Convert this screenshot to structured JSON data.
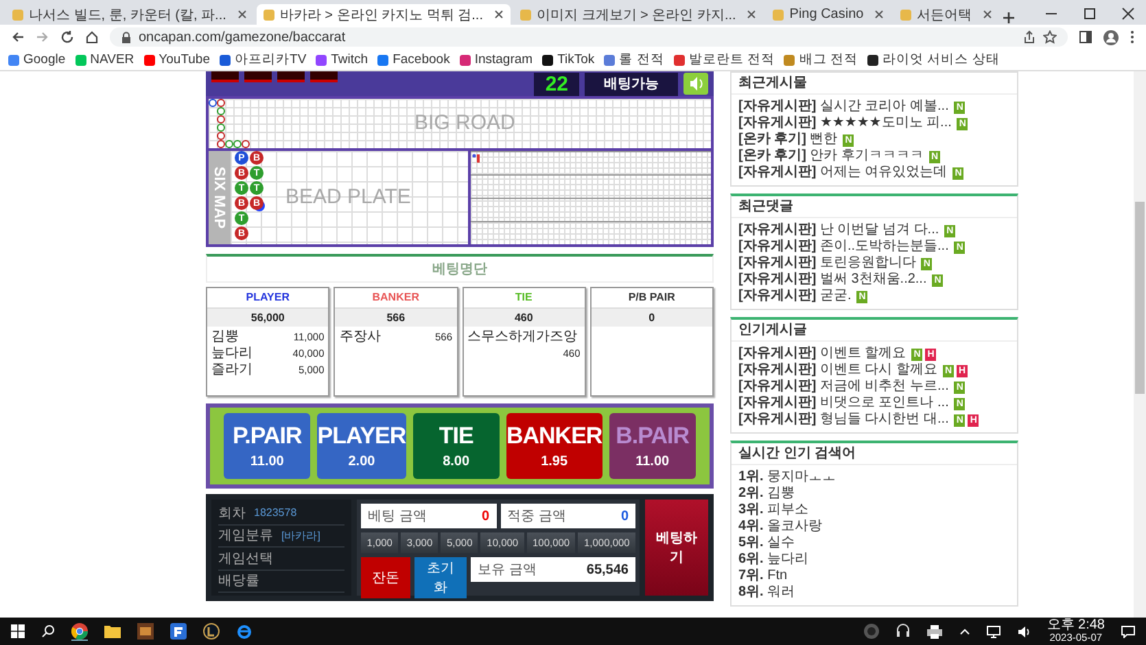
{
  "browser": {
    "tabs": [
      {
        "title": "나서스 빌드, 룬, 카운터 (칼, 파...",
        "selected": false
      },
      {
        "title": "바카라 > 온라인 카지노 먹튀 검...",
        "selected": true
      },
      {
        "title": "이미지 크게보기 > 온라인 카지...",
        "selected": false
      },
      {
        "title": "Ping Casino",
        "selected": false
      },
      {
        "title": "서든어택",
        "selected": false
      }
    ],
    "url": "oncapan.com/gamezone/baccarat",
    "bookmarks": [
      "Google",
      "NAVER",
      "YouTube",
      "아프리카TV",
      "Twitch",
      "Facebook",
      "Instagram",
      "TikTok",
      "롤 전적",
      "발로란트 전적",
      "배그 전적",
      "라이엇 서비스 상태"
    ]
  },
  "game": {
    "countdown": "22",
    "status": "배팅가능",
    "big_road": {
      "label": "BIG ROAD",
      "columns": [
        [
          {
            "kind": "player"
          }
        ],
        [
          {
            "kind": "banker"
          },
          {
            "kind": "tie"
          },
          {
            "kind": "banker"
          },
          {
            "kind": "tie"
          },
          {
            "kind": "banker"
          },
          {
            "kind": "banker"
          }
        ],
        [
          null,
          null,
          null,
          null,
          null,
          {
            "kind": "tie"
          }
        ],
        [
          null,
          null,
          null,
          null,
          null,
          {
            "kind": "tie"
          }
        ],
        [
          null,
          null,
          null,
          null,
          null,
          {
            "kind": "banker"
          }
        ]
      ]
    },
    "six_map": {
      "label": "SIX MAP",
      "bead_label": "BEAD PLATE",
      "columns": [
        [
          {
            "label": "P",
            "kind": "player",
            "pair": false
          },
          {
            "label": "B",
            "kind": "banker",
            "pair": false
          },
          {
            "label": "T",
            "kind": "tie",
            "pair": false
          },
          {
            "label": "B",
            "kind": "banker",
            "pair": false
          },
          {
            "label": "T",
            "kind": "tie",
            "pair": false
          },
          {
            "label": "B",
            "kind": "banker",
            "pair": false
          }
        ],
        [
          {
            "label": "B",
            "kind": "banker",
            "pair": false
          },
          {
            "label": "T",
            "kind": "tie",
            "pair": false
          },
          {
            "label": "T",
            "kind": "tie",
            "pair": false
          },
          {
            "label": "B",
            "kind": "banker",
            "pair": true
          }
        ]
      ]
    }
  },
  "betting_list": {
    "title": "베팅명단",
    "columns": [
      {
        "label": "PLAYER",
        "kind": "player",
        "total": "56,000",
        "bets": [
          {
            "name": "김뿡",
            "amount": "11,000"
          },
          {
            "name": "늪다리",
            "amount": "40,000"
          },
          {
            "name": "즐라기",
            "amount": "5,000"
          }
        ]
      },
      {
        "label": "BANKER",
        "kind": "banker",
        "total": "566",
        "bets": [
          {
            "name": "주장사",
            "amount": "566"
          }
        ]
      },
      {
        "label": "TIE",
        "kind": "tie",
        "total": "460",
        "bets": [
          {
            "name": "스무스하게가즈앙",
            "amount": "460"
          }
        ]
      },
      {
        "label": "P/B PAIR",
        "kind": "pair",
        "total": "0"
      }
    ]
  },
  "bet_options": [
    {
      "label": "P.PAIR",
      "odds": "11.00",
      "kind": "player_pair"
    },
    {
      "label": "PLAYER",
      "odds": "2.00",
      "kind": "player"
    },
    {
      "label": "TIE",
      "odds": "8.00",
      "kind": "tie"
    },
    {
      "label": "BANKER",
      "odds": "1.95",
      "kind": "banker"
    },
    {
      "label": "B.PAIR",
      "odds": "11.00",
      "kind": "banker_pair"
    }
  ],
  "bet_panel": {
    "info": [
      {
        "label": "회차",
        "value": "1823578"
      },
      {
        "label": "게임분류",
        "value": "[바카라]"
      },
      {
        "label": "게임선택"
      },
      {
        "label": "배당률"
      }
    ],
    "bet_amount": {
      "label": "베팅 금액",
      "value": "0"
    },
    "win_amount": {
      "label": "적중 금액",
      "value": "0"
    },
    "chips": [
      "1,000",
      "3,000",
      "5,000",
      "10,000",
      "100,000",
      "1,000,000"
    ],
    "change_button": "잔돈",
    "reset_button": "초기화",
    "balance": {
      "label": "보유 금액",
      "value": "65,546"
    },
    "bet_button": "베팅하기"
  },
  "sidebar": [
    {
      "title": "최근게시물",
      "items": [
        {
          "category": "[자유게시판]",
          "text": "실시간 코리아 예볼...",
          "badges": [
            {
              "label": "N",
              "kind": "new"
            }
          ]
        },
        {
          "category": "[자유게시판]",
          "text": "★★★★★도미노 피...",
          "badges": [
            {
              "label": "N",
              "kind": "new"
            }
          ]
        },
        {
          "category": "[온카 후기]",
          "text": "뻔한",
          "badges": [
            {
              "label": "N",
              "kind": "new"
            }
          ]
        },
        {
          "category": "[온카 후기]",
          "text": "안카 후기ㅋㅋㅋㅋ",
          "badges": [
            {
              "label": "N",
              "kind": "new"
            }
          ]
        },
        {
          "category": "[자유게시판]",
          "text": "어제는 여유있었는데",
          "badges": [
            {
              "label": "N",
              "kind": "new"
            }
          ]
        }
      ]
    },
    {
      "title": "최근댓글",
      "items": [
        {
          "category": "[자유게시판]",
          "text": "난 이번달 넘겨 다...",
          "badges": [
            {
              "label": "N",
              "kind": "new"
            }
          ]
        },
        {
          "category": "[자유게시판]",
          "text": "존이..도박하는분들...",
          "badges": [
            {
              "label": "N",
              "kind": "new"
            }
          ]
        },
        {
          "category": "[자유게시판]",
          "text": "토린응원합니다",
          "badges": [
            {
              "label": "N",
              "kind": "new"
            }
          ]
        },
        {
          "category": "[자유게시판]",
          "text": "벌써 3천채움..2...",
          "badges": [
            {
              "label": "N",
              "kind": "new"
            }
          ]
        },
        {
          "category": "[자유게시판]",
          "text": "굳굳.",
          "badges": [
            {
              "label": "N",
              "kind": "new"
            }
          ]
        }
      ]
    },
    {
      "title": "인기게시글",
      "items": [
        {
          "category": "[자유게시판]",
          "text": "이벤트 할께요",
          "badges": [
            {
              "label": "N",
              "kind": "new"
            },
            {
              "label": "H",
              "kind": "hot"
            }
          ]
        },
        {
          "category": "[자유게시판]",
          "text": "이벤트 다시 할께요",
          "badges": [
            {
              "label": "N",
              "kind": "new"
            },
            {
              "label": "H",
              "kind": "hot"
            }
          ]
        },
        {
          "category": "[자유게시판]",
          "text": "저금에 비추천 누르...",
          "badges": [
            {
              "label": "N",
              "kind": "new"
            }
          ]
        },
        {
          "category": "[자유게시판]",
          "text": "비댓으로 포인트나 ...",
          "badges": [
            {
              "label": "N",
              "kind": "new"
            }
          ]
        },
        {
          "category": "[자유게시판]",
          "text": "형님들 다시한번 대...",
          "badges": [
            {
              "label": "N",
              "kind": "new"
            },
            {
              "label": "H",
              "kind": "hot"
            }
          ]
        }
      ]
    },
    {
      "title": "실시간 인기 검색어",
      "items": [
        {
          "rank": "1위.",
          "text": "뭉지마ㅗㅗ"
        },
        {
          "rank": "2위.",
          "text": "김뿡"
        },
        {
          "rank": "3위.",
          "text": "피부소"
        },
        {
          "rank": "4위.",
          "text": "올코사랑"
        },
        {
          "rank": "5위.",
          "text": "실수"
        },
        {
          "rank": "6위.",
          "text": "늪다리"
        },
        {
          "rank": "7위.",
          "text": "Ftn"
        },
        {
          "rank": "8위.",
          "text": "워러"
        }
      ]
    }
  ],
  "taskbar": {
    "time": "오후 2:48",
    "date": "2023-05-07"
  }
}
